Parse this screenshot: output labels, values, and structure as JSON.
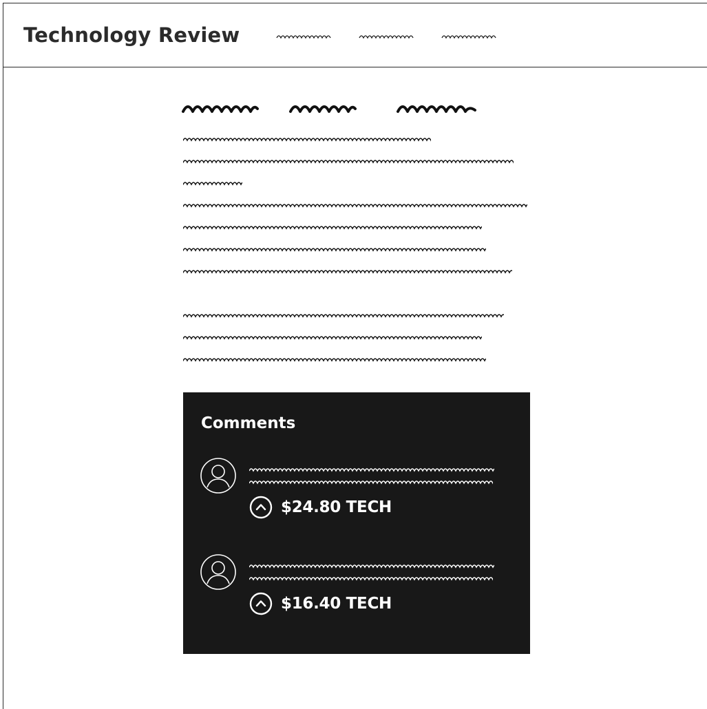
{
  "header": {
    "title": "Technology Review",
    "nav_items": [
      {
        "name": "nav-link-1",
        "icon": "scribble-placeholder"
      },
      {
        "name": "nav-link-2",
        "icon": "scribble-placeholder"
      },
      {
        "name": "nav-link-3",
        "icon": "scribble-placeholder"
      }
    ]
  },
  "comments": {
    "heading": "Comments",
    "items": [
      {
        "avatar_icon": "user-avatar-icon",
        "vote_icon": "chevron-up-circle-icon",
        "tip": "$24.80 TECH"
      },
      {
        "avatar_icon": "user-avatar-icon",
        "vote_icon": "chevron-up-circle-icon",
        "tip": "$16.40 TECH"
      }
    ]
  },
  "colors": {
    "text": "#2b2b2b",
    "border": "#2a2a2a",
    "comments_bg": "#181818",
    "comments_text": "#ffffff"
  }
}
